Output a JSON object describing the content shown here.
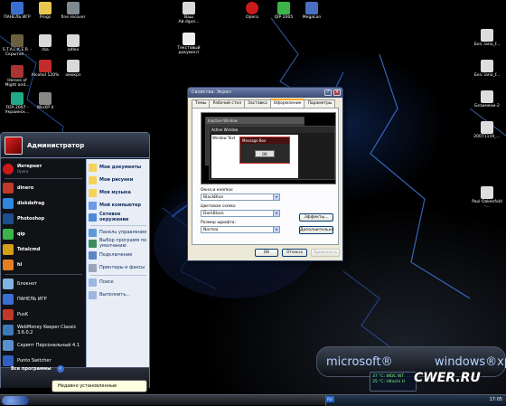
{
  "desktop": {
    "icons": [
      {
        "label": "ПАНЕЛЬ ИГР",
        "color": "#3a6fd0"
      },
      {
        "label": "Progs",
        "color": "#e8c650"
      },
      {
        "label": "fine recover",
        "color": "#808890"
      },
      {
        "label": "Ваш Ай.dgun...",
        "color": "#d9d9d9"
      },
      {
        "label": "Opera",
        "color": "#cc1a1a"
      },
      {
        "label": "QIP 2005",
        "color": "#3bb34a"
      },
      {
        "label": "MegaLan",
        "color": "#4a6fc0"
      },
      {
        "label": "S.T.A.L.K.E.R. - Скрытая ...",
        "color": "#6a6040"
      },
      {
        "label": "rba",
        "color": "#d9d9d9"
      },
      {
        "label": "adlex",
        "color": "#d9d9d9"
      },
      {
        "label": "Текстовый документ",
        "color": "#eeeeee"
      },
      {
        "label": "Alcohol 120%",
        "color": "#c42b2b"
      },
      {
        "label": "омокрэ",
        "color": "#d9d9d9"
      },
      {
        "label": "Heroes of Might and...",
        "color": "#a33"
      },
      {
        "label": "FIFA 2007 - Украинск...",
        "color": "#2a8"
      },
      {
        "label": "WinXP 4",
        "color": "#888"
      },
      {
        "label": "Без..iano_f...",
        "color": "#ddd"
      },
      {
        "label": "Без..iano_f...",
        "color": "#ddd"
      },
      {
        "label": "Безимени-2",
        "color": "#ddd"
      },
      {
        "label": "20071119_...",
        "color": "#ddd"
      },
      {
        "label": "Paul Oakenfold -...",
        "color": "#ddd"
      }
    ]
  },
  "start_menu": {
    "user": "Администратор",
    "pinned": [
      {
        "label": "Интернет",
        "sub": "Opera",
        "color": "#cc1a1a"
      },
      {
        "label": "dinero",
        "sub": "",
        "color": "#c0392b"
      },
      {
        "label": "diskdefrag",
        "sub": "",
        "color": "#2e86de"
      },
      {
        "label": "Photoshop",
        "sub": "",
        "color": "#1e4e8c"
      },
      {
        "label": "qip",
        "sub": "",
        "color": "#3bb34a"
      },
      {
        "label": "Totalcmd",
        "sub": "",
        "color": "#d4a017"
      },
      {
        "label": "hl",
        "sub": "",
        "color": "#e67e22"
      }
    ],
    "recent": [
      {
        "label": "Блокнот",
        "color": "#7fb3e0"
      },
      {
        "label": "ПАНЕЛЬ ИГР",
        "color": "#3a6fd0"
      },
      {
        "label": "РusK",
        "color": "#c0392b"
      },
      {
        "label": "WebMoney Keeper Classic 3.6.0.2",
        "color": "#3d7ab8"
      },
      {
        "label": "Скрипт Персональный 4.1",
        "color": "#5a8fd0"
      },
      {
        "label": "Punto Switcher",
        "color": "#3060c0"
      }
    ],
    "all_programs": "Все программы",
    "places": [
      {
        "label": "Мои документы",
        "bold": true,
        "color": "#f5d35b"
      },
      {
        "label": "Мои рисунки",
        "bold": true,
        "color": "#f5d35b"
      },
      {
        "label": "Моя музыка",
        "bold": true,
        "color": "#f5d35b"
      },
      {
        "label": "Мой компьютер",
        "bold": true,
        "color": "#6b9be6"
      },
      {
        "label": "Сетевое окружение",
        "bold": true,
        "color": "#4f8ad8"
      },
      {
        "label": "Панель управления",
        "bold": false,
        "color": "#5f9bd8"
      },
      {
        "label": "Выбор программ по умолчанию",
        "bold": false,
        "color": "#3d8e5e"
      },
      {
        "label": "Подключение",
        "bold": false,
        "color": "#5a86c6"
      },
      {
        "label": "Принтеры и факсы",
        "bold": false,
        "color": "#9aa5b8"
      },
      {
        "label": "Поиск",
        "bold": false,
        "color": "#9cb7e0"
      },
      {
        "label": "Выполнить...",
        "bold": false,
        "color": "#9cb7e0"
      }
    ]
  },
  "tooltip": "Недавно установленные программы.",
  "dialog": {
    "title": "Свойства: Экран",
    "tabs": [
      "Темы",
      "Рабочий стол",
      "Заставка",
      "Оформление",
      "Параметры"
    ],
    "active_tab": 3,
    "preview": {
      "inactive_title": "Inactive Window",
      "active_title": "Active Window",
      "window_text": "Window Text",
      "msg_title": "Message Box",
      "ok_label": "OK"
    },
    "fields": [
      {
        "label": "Окна и кнопки:",
        "value": "BlackBlue"
      },
      {
        "label": "Цветовая схема:",
        "value": "DarkBlack"
      },
      {
        "label": "Размер шрифта:",
        "value": "Normal"
      }
    ],
    "effects_label": "Эффекты...",
    "advanced_label": "Дополнительно",
    "ok_label": "OK",
    "cancel_label": "Отмена",
    "apply_label": "Применить"
  },
  "branding": {
    "microsoft": "microsoft®",
    "windows": "windows®xp"
  },
  "weather": {
    "line1": "37 °C: WDC WT",
    "line2": "35 °C: Hitachi H"
  },
  "watermark": "CWER.RU",
  "taskbar": {
    "lang": "RU",
    "clock": "17:05"
  }
}
